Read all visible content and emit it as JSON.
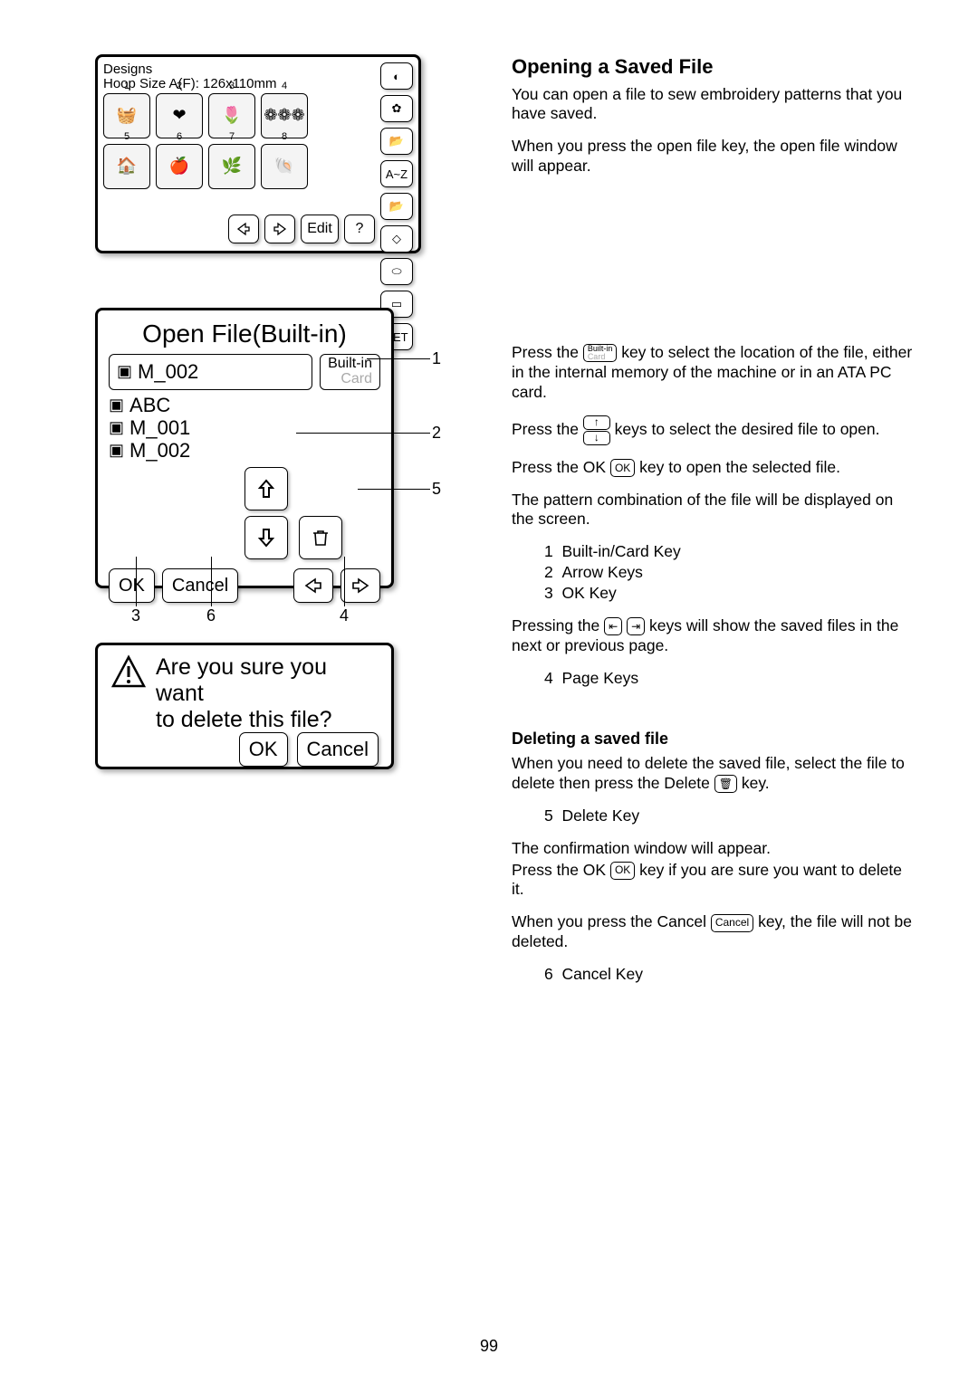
{
  "page_number": "99",
  "designs_panel": {
    "title": "Designs",
    "hoop": "Hoop Size A(F): 126x110mm",
    "cell_numbers": [
      "1",
      "2",
      "3",
      "4",
      "5",
      "6",
      "7",
      "8"
    ],
    "side": {
      "az": "A~Z",
      "set": "SET",
      "edit": "Edit",
      "help": "?"
    }
  },
  "open_panel": {
    "title": "Open File(Built-in)",
    "current_file": "M_002",
    "builtin_label": "Built-in",
    "card_label": "Card",
    "files": [
      "ABC",
      "M_001",
      "M_002"
    ],
    "ok": "OK",
    "cancel": "Cancel",
    "callouts": {
      "c1": "1",
      "c2": "2",
      "c3": "3",
      "c4": "4",
      "c5": "5",
      "c6": "6"
    }
  },
  "confirm_panel": {
    "message_l1": "Are you sure you want",
    "message_l2": "to delete this file?",
    "ok": "OK",
    "cancel": "Cancel"
  },
  "text": {
    "h_open": "Opening a Saved File",
    "open_p1": "You can open a file to sew embroidery patterns that you have saved.",
    "open_p2": "When you press the open file key, the open file window will appear.",
    "press_the": "Press the",
    "loc_tail": " key to select the location of the file, either in the internal memory of the machine or in an ATA PC card.",
    "arrow_tail": " keys to select the desired file to open.",
    "ok_lead": "Press the OK ",
    "ok_tail": " key to open the selected file.",
    "disp": "The pattern combination of the file will be displayed on the screen.",
    "keylist1": {
      "n1": "1",
      "t1": "Built-in/Card Key",
      "n2": "2",
      "t2": "Arrow Keys",
      "n3": "3",
      "t3": "OK Key"
    },
    "page_lead": "Pressing the",
    "page_tail": "keys will show the saved files in the next or previous page.",
    "keylist2": {
      "n": "4",
      "t": "Page Keys"
    },
    "h_del": "Deleting a saved file",
    "del_p1a": "When you need to delete the saved file, select the file to delete then press the Delete ",
    "del_p1b": " key.",
    "keylist3": {
      "n": "5",
      "t": "Delete Key"
    },
    "conf1": "The confirmation window will appear.",
    "conf2a": "Press the OK ",
    "conf2b": " key if you are sure you want to delete it.",
    "conf3a": "When you press the Cancel ",
    "conf3b": " key, the file will not be deleted.",
    "keylist4": {
      "n": "6",
      "t": "Cancel Key"
    },
    "inline": {
      "builtin": "Built-in",
      "card": "Card",
      "ok": "OK",
      "cancel": "Cancel"
    }
  }
}
